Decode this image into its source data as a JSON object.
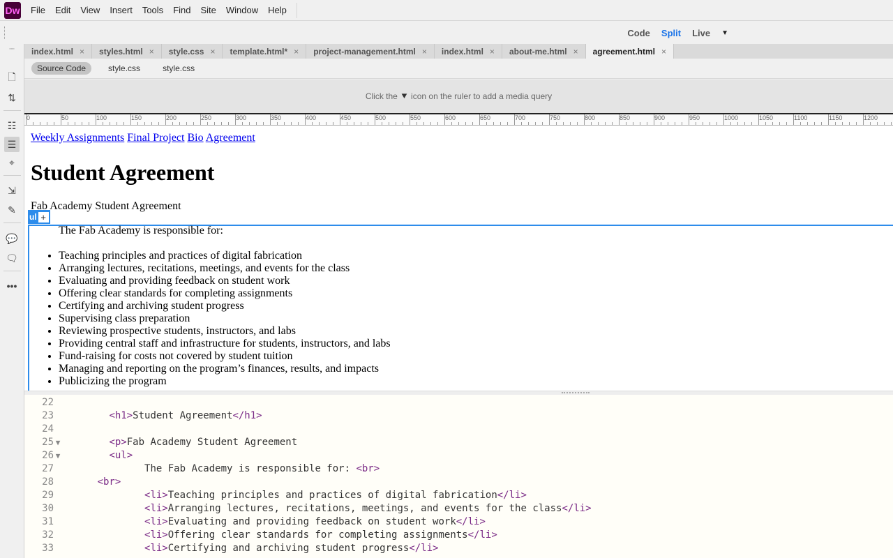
{
  "app": {
    "logo": "Dw",
    "brand_color": "#470137"
  },
  "menu": [
    "File",
    "Edit",
    "View",
    "Insert",
    "Tools",
    "Find",
    "Site",
    "Window",
    "Help"
  ],
  "view_modes": {
    "code": "Code",
    "split": "Split",
    "live": "Live",
    "active": "Split",
    "dropdown_icon": "caret-down-icon"
  },
  "tabs": [
    {
      "label": "index.html",
      "active": false
    },
    {
      "label": "styles.html",
      "active": false
    },
    {
      "label": "style.css",
      "active": false
    },
    {
      "label": "template.html*",
      "active": false
    },
    {
      "label": "project-management.html",
      "active": false
    },
    {
      "label": "index.html",
      "active": false
    },
    {
      "label": "about-me.html",
      "active": false
    },
    {
      "label": "agreement.html",
      "active": true
    }
  ],
  "related_files": [
    "Source Code",
    "style.css",
    "style.css"
  ],
  "media_query": {
    "before": "Click the",
    "after": "icon on the ruler to add a media query"
  },
  "ruler": {
    "start": 0,
    "end": 1200,
    "step": 50
  },
  "design": {
    "nav_links": [
      "Weekly Assignments",
      "Final Project",
      "Bio",
      "Agreement"
    ],
    "h1": "Student Agreement",
    "paragraph": "Fab Academy Student Agreement",
    "selected_tag": "ul",
    "intro": "The Fab Academy is responsible for:",
    "items": [
      "Teaching principles and practices of digital fabrication",
      "Arranging lectures, recitations, meetings, and events for the class",
      "Evaluating and providing feedback on student work",
      "Offering clear standards for completing assignments",
      "Certifying and archiving student progress",
      "Supervising class preparation",
      "Reviewing prospective students, instructors, and labs",
      "Providing central staff and infrastructure for students, instructors, and labs",
      "Fund-raising for costs not covered by student tuition",
      "Managing and reporting on the program’s finances, results, and impacts",
      "Publicizing the program"
    ]
  },
  "code_lines": [
    {
      "n": "22",
      "indent": "",
      "parts": []
    },
    {
      "n": "23",
      "indent": "    ",
      "parts": [
        [
          "t",
          "<h1>"
        ],
        [
          "x",
          "Student Agreement"
        ],
        [
          "t",
          "</h1>"
        ]
      ]
    },
    {
      "n": "24",
      "indent": "",
      "parts": []
    },
    {
      "n": "25",
      "fold": true,
      "indent": "    ",
      "parts": [
        [
          "t",
          "<p>"
        ],
        [
          "x",
          "Fab Academy Student Agreement"
        ]
      ]
    },
    {
      "n": "26",
      "fold": true,
      "indent": "    ",
      "parts": [
        [
          "t",
          "<ul>"
        ]
      ]
    },
    {
      "n": "27",
      "indent": "          ",
      "parts": [
        [
          "x",
          "The Fab Academy is responsible for: "
        ],
        [
          "t",
          "<br>"
        ]
      ]
    },
    {
      "n": "28",
      "indent": "  ",
      "parts": [
        [
          "t",
          "<br>"
        ]
      ]
    },
    {
      "n": "29",
      "indent": "          ",
      "parts": [
        [
          "t",
          "<li>"
        ],
        [
          "x",
          "Teaching principles and practices of digital fabrication"
        ],
        [
          "t",
          "</li>"
        ]
      ]
    },
    {
      "n": "30",
      "indent": "          ",
      "parts": [
        [
          "t",
          "<li>"
        ],
        [
          "x",
          "Arranging lectures, recitations, meetings, and events for the class"
        ],
        [
          "t",
          "</li>"
        ]
      ]
    },
    {
      "n": "31",
      "indent": "          ",
      "parts": [
        [
          "t",
          "<li>"
        ],
        [
          "x",
          "Evaluating and providing feedback on student work"
        ],
        [
          "t",
          "</li>"
        ]
      ]
    },
    {
      "n": "32",
      "indent": "          ",
      "parts": [
        [
          "t",
          "<li>"
        ],
        [
          "x",
          "Offering clear standards for completing assignments"
        ],
        [
          "t",
          "</li>"
        ]
      ]
    },
    {
      "n": "33",
      "indent": "          ",
      "parts": [
        [
          "t",
          "<li>"
        ],
        [
          "x",
          "Certifying and archiving student progress"
        ],
        [
          "t",
          "</li>"
        ]
      ]
    }
  ]
}
